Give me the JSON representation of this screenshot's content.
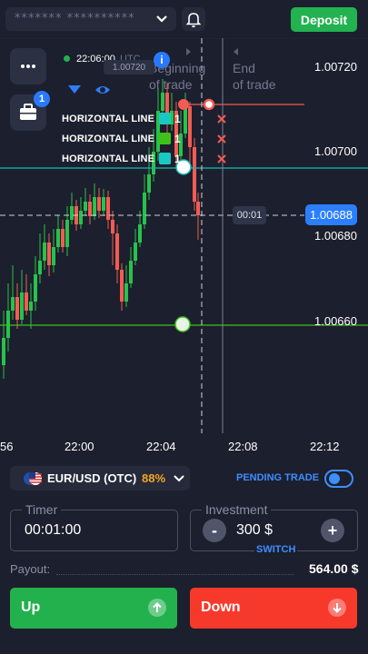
{
  "header": {
    "account_mask": "******* **********",
    "deposit_label": "Deposit"
  },
  "chart": {
    "time_readout": "22:06:00",
    "utc_label": "UTC",
    "price_overlay": "1.00720",
    "beginning_label_1": "Beginning",
    "beginning_label_2": "of trade",
    "end_label_1": "End",
    "end_label_2": "of trade",
    "portfolio_badge": "1",
    "info_glyph": "i",
    "horizontal_lines": [
      {
        "label": "HORIZONTAL LINE",
        "color": "#19c8c2",
        "count": "1"
      },
      {
        "label": "HORIZONTAL LINE",
        "color": "#3ec21a",
        "count": "1"
      },
      {
        "label": "HORIZONTAL LINE",
        "color": "#19c8c2",
        "count": "1"
      }
    ],
    "price_levels": [
      "1.00720",
      "1.00700",
      "1.00680",
      "1.00660"
    ],
    "current_price": "1.00688",
    "countdown": "00:01",
    "time_labels": [
      "56",
      "22:00",
      "22:04",
      "22:08",
      "22:12"
    ]
  },
  "controls": {
    "pair": "EUR/USD (OTC)",
    "payout_pct": "88%",
    "pending_trade": "PENDING TRADE",
    "timer_label": "Timer",
    "timer_value": "00:01:00",
    "investment_label": "Investment",
    "investment_value": "300 $",
    "switch_label": "SWITCH",
    "minus": "-",
    "plus": "+",
    "payout_label": "Payout:",
    "payout_value": "564.00 $",
    "up_label": "Up",
    "down_label": "Down"
  },
  "colors": {
    "background": "#1c1f2d",
    "up": "#23b14d",
    "down": "#f7392b",
    "accent": "#2979ff",
    "candle_up": "#27c24c",
    "candle_down": "#f25c54"
  }
}
